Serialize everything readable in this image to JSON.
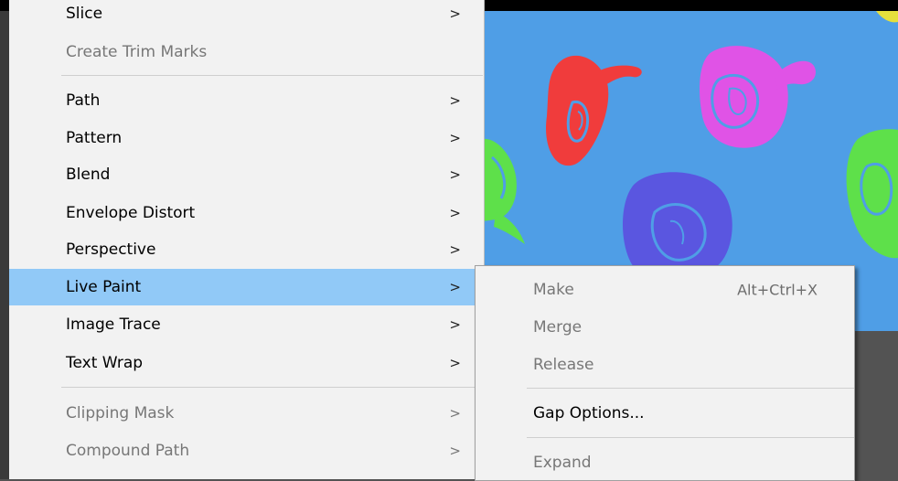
{
  "object_menu": {
    "items": [
      {
        "label": "Slice",
        "submenu": true,
        "enabled": true
      },
      {
        "label": "Create Trim Marks",
        "submenu": false,
        "enabled": false
      },
      {
        "label": "Path",
        "submenu": true,
        "enabled": true
      },
      {
        "label": "Pattern",
        "submenu": true,
        "enabled": true
      },
      {
        "label": "Blend",
        "submenu": true,
        "enabled": true
      },
      {
        "label": "Envelope Distort",
        "submenu": true,
        "enabled": true
      },
      {
        "label": "Perspective",
        "submenu": true,
        "enabled": true
      },
      {
        "label": "Live Paint",
        "submenu": true,
        "enabled": true,
        "highlighted": true
      },
      {
        "label": "Image Trace",
        "submenu": true,
        "enabled": true
      },
      {
        "label": "Text Wrap",
        "submenu": true,
        "enabled": true
      },
      {
        "label": "Clipping Mask",
        "submenu": true,
        "enabled": false
      },
      {
        "label": "Compound Path",
        "submenu": true,
        "enabled": false
      }
    ],
    "arrow_glyph": ">"
  },
  "live_paint_submenu": {
    "items": [
      {
        "label": "Make",
        "shortcut": "Alt+Ctrl+X",
        "enabled": false
      },
      {
        "label": "Merge",
        "enabled": false
      },
      {
        "label": "Release",
        "enabled": false
      },
      {
        "label": "Gap Options...",
        "enabled": true
      },
      {
        "label": "Expand",
        "enabled": false
      }
    ]
  },
  "colors": {
    "menu_background": "#f2f2f2",
    "highlight": "#91c9f7",
    "artboard_background": "#4f9ee6",
    "workspace": "#535353",
    "shape_red": "#f03c3c",
    "shape_magenta": "#e053e6",
    "shape_green": "#5ee04a",
    "shape_blue": "#5a56e0"
  }
}
